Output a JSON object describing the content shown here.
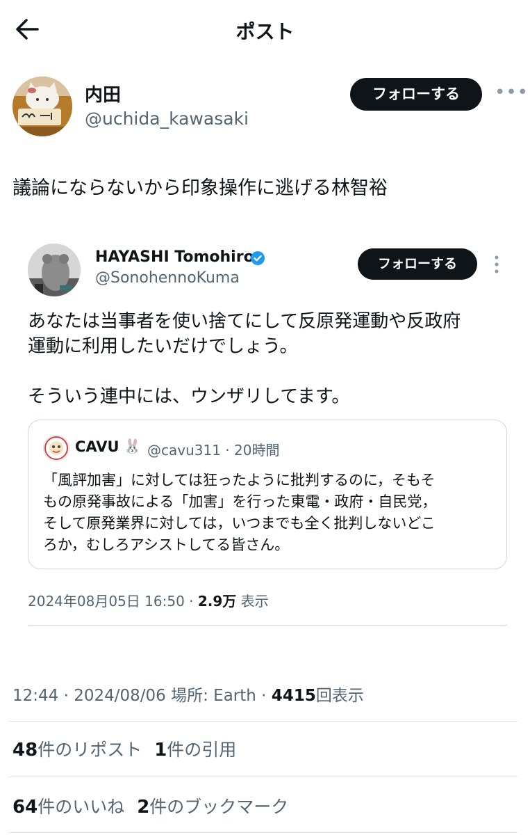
{
  "header": {
    "title": "ポスト"
  },
  "post": {
    "author_name": "内田",
    "author_handle": "@uchida_kawasaki",
    "follow_label": "フォローする",
    "text": "議論にならないから印象操作に逃げる林智裕",
    "time": "12:44",
    "date": "2024/08/06",
    "location": "場所: Earth",
    "views": "4415",
    "views_label": "回表示",
    "reposts": "48",
    "reposts_label": "件のリポスト",
    "quotes": "1",
    "quotes_label": "件の引用",
    "likes": "64",
    "likes_label": "件のいいね",
    "bookmarks": "2",
    "bookmarks_label": "件のブックマーク"
  },
  "embedded": {
    "author_name": "HAYASHI Tomohiro",
    "author_handle": "@SonohennoKuma",
    "follow_label": "フォローする",
    "body_line1": "あなたは当事者を使い捨てにして反原発運動や反政府",
    "body_line2": "運動に利用したいだけでしょう。",
    "body_line3": "そういう連中には、ウンザリしてます。",
    "datetime": "2024年08月05日 16:50 · ",
    "views": "2.9万",
    "views_label": " 表示",
    "quote": {
      "author_name": "CAVU",
      "emoji": "🐰",
      "meta": "@cavu311 · 20時間",
      "line1": "「風評加害」に対しては狂ったように批判するのに，そもそ",
      "line2": "もの原発事故による「加害」を行った東電・政府・自民党，",
      "line3": "そして原発業界に対しては，いつまでも全く批判しないどこ",
      "line4": "ろか，むしろアシストしてる皆さん。"
    }
  },
  "colors": {
    "text": "#0f1419",
    "secondary": "#536471",
    "verified": "#1d9bf0",
    "border": "#cfd9de"
  }
}
